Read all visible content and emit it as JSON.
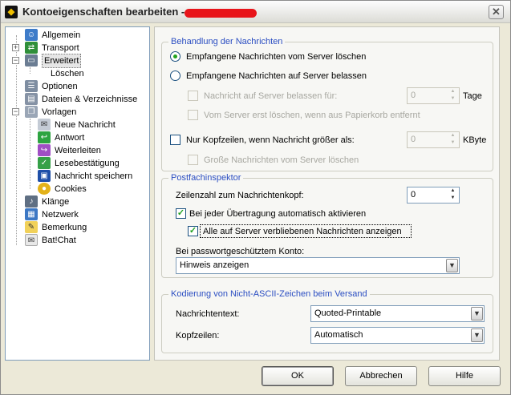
{
  "window": {
    "title": "Kontoeigenschaften bearbeiten -",
    "close_glyph": "✕"
  },
  "tree": {
    "items": [
      {
        "label": "Allgemein",
        "icon": "user-icon"
      },
      {
        "label": "Transport",
        "icon": "network-icon"
      },
      {
        "label": "Erweitert",
        "icon": "monitor-icon"
      },
      {
        "label": "Löschen",
        "icon": "blank-icon"
      },
      {
        "label": "Optionen",
        "icon": "options-icon"
      },
      {
        "label": "Dateien & Verzeichnisse",
        "icon": "folder-icon"
      },
      {
        "label": "Vorlagen",
        "icon": "templates-icon"
      },
      {
        "label": "Neue Nachricht",
        "icon": "new-message-icon"
      },
      {
        "label": "Antwort",
        "icon": "reply-icon"
      },
      {
        "label": "Weiterleiten",
        "icon": "forward-icon"
      },
      {
        "label": "Lesebestätigung",
        "icon": "receipt-icon"
      },
      {
        "label": "Nachricht speichern",
        "icon": "save-icon"
      },
      {
        "label": "Cookies",
        "icon": "cookie-icon"
      },
      {
        "label": "Klänge",
        "icon": "speaker-icon"
      },
      {
        "label": "Netzwerk",
        "icon": "lan-icon"
      },
      {
        "label": "Bemerkung",
        "icon": "note-icon"
      },
      {
        "label": "Bat!Chat",
        "icon": "chat-icon"
      }
    ]
  },
  "groups": {
    "handling": {
      "legend": "Behandlung der Nachrichten",
      "radio_delete": "Empfangene Nachrichten vom Server löschen",
      "radio_keep": "Empfangene Nachrichten auf Server belassen",
      "keep_for_label": "Nachricht auf Server belassen für:",
      "keep_for_value": "0",
      "keep_for_unit": "Tage",
      "delete_after_trash": "Vom Server erst löschen, wenn aus Papierkorb entfernt",
      "headers_only_label": "Nur Kopfzeilen, wenn Nachricht größer als:",
      "headers_only_value": "0",
      "headers_only_unit": "KByte",
      "delete_large": "Große Nachrichten vom Server löschen"
    },
    "inspector": {
      "legend": "Postfachinspektor",
      "lines_label": "Zeilenzahl zum Nachrichtenkopf:",
      "lines_value": "0",
      "auto_activate": "Bei jeder Übertragung automatisch aktivieren",
      "show_all": "Alle auf Server verbliebenen Nachrichten anzeigen",
      "pw_label": "Bei passwortgeschütztem Konto:",
      "pw_value": "Hinweis anzeigen"
    },
    "encoding": {
      "legend": "Kodierung von Nicht-ASCII-Zeichen beim Versand",
      "body_label": "Nachrichtentext:",
      "body_value": "Quoted-Printable",
      "header_label": "Kopfzeilen:",
      "header_value": "Automatisch"
    }
  },
  "buttons": {
    "ok": "OK",
    "cancel": "Abbrechen",
    "help": "Hilfe"
  }
}
